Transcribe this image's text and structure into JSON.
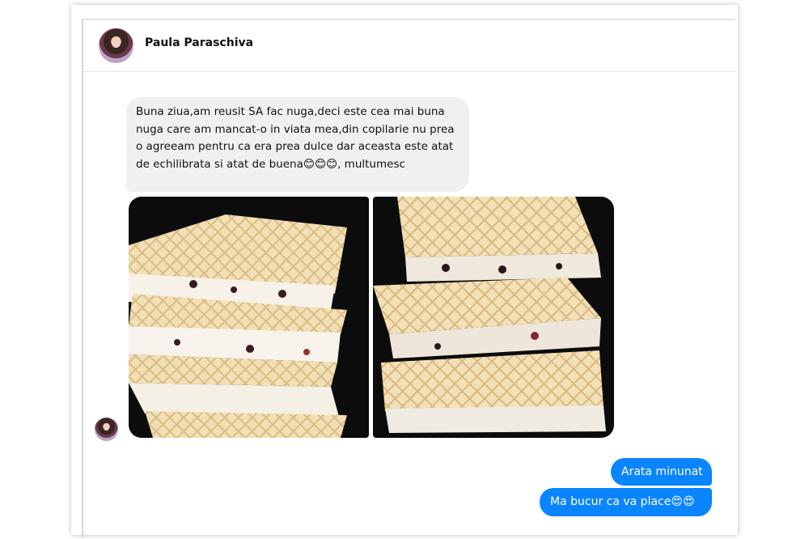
{
  "conversation": {
    "contact_name": "Paula Paraschiva"
  },
  "messages": {
    "incoming_text": "Buna ziua,am reusit SA fac nuga,deci este cea mai buna nuga care am mancat-o in viata mea,din copilarie nu prea o agreeam  pentru ca era prea dulce dar aceasta este atat de echilibrata si atat de buena😊😊😊, multumesc",
    "outgoing": [
      {
        "text": "Arata minunat"
      },
      {
        "text": "Ma bucur ca va place😍😍"
      }
    ]
  },
  "colors": {
    "outgoing_bubble": "#0a84ff",
    "incoming_bubble": "#f0f0f0"
  }
}
